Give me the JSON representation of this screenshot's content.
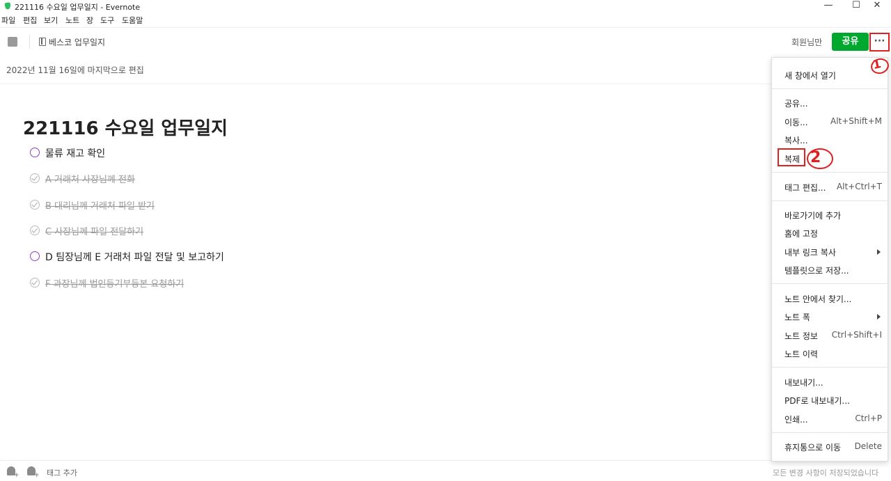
{
  "window": {
    "title": "221116 수요일 업무일지 - Evernote",
    "controls": {
      "minimize": "—",
      "maximize": "☐",
      "close": "✕"
    }
  },
  "menubar": [
    "파일",
    "편집",
    "보기",
    "노트",
    "장",
    "도구",
    "도움말"
  ],
  "toolbar": {
    "notebook": "베스코 업무일지",
    "membership": "회원님만",
    "share_label": "공유",
    "more_label": "···"
  },
  "last_edited": "2022년 11월 16일에 마지막으로 편집",
  "note": {
    "title": "221116 수요일 업무일지",
    "tasks": [
      {
        "text": "물류 재고 확인",
        "done": false
      },
      {
        "text": "A 거래처 사장님께 전화",
        "done": true
      },
      {
        "text": "B 대리님께 거래처 파일 받기",
        "done": true
      },
      {
        "text": "C 사장님께 파일 전달하기",
        "done": true
      },
      {
        "text": "D 팀장님께 E 거래처 파일 전달 및 보고하기",
        "done": false
      },
      {
        "text": "F 과장님께 법인등기부등본 요청하기",
        "done": true
      }
    ]
  },
  "context_menu": {
    "open_new_window": "새 창에서 열기",
    "share": "공유...",
    "move": "이동...",
    "move_shortcut": "Alt+Shift+M",
    "copy": "복사...",
    "duplicate": "복제",
    "edit_tags": "태그 편집...",
    "edit_tags_shortcut": "Alt+Ctrl+T",
    "add_shortcut": "바로가기에 추가",
    "pin_home": "홈에 고정",
    "copy_internal_link": "내부 링크 복사",
    "save_template": "템플릿으로 저장...",
    "find_in_note": "노트 안에서 찾기...",
    "note_width": "노트 폭",
    "note_info": "노트 정보",
    "note_info_shortcut": "Ctrl+Shift+I",
    "note_history": "노트 이력",
    "export": "내보내기...",
    "export_pdf": "PDF로 내보내기...",
    "print": "인쇄...",
    "print_shortcut": "Ctrl+P",
    "move_trash": "휴지통으로 이동",
    "move_trash_shortcut": "Delete"
  },
  "annotations": {
    "step1": "1",
    "step2": "2"
  },
  "footer": {
    "add_tag": "태그 추가",
    "save_status": "모든 변경 사항이 저장되었습니다"
  },
  "colors": {
    "share_button": "#00a82d",
    "annotation_red": "#e02020",
    "checkbox_purple": "#8e3fc7"
  }
}
